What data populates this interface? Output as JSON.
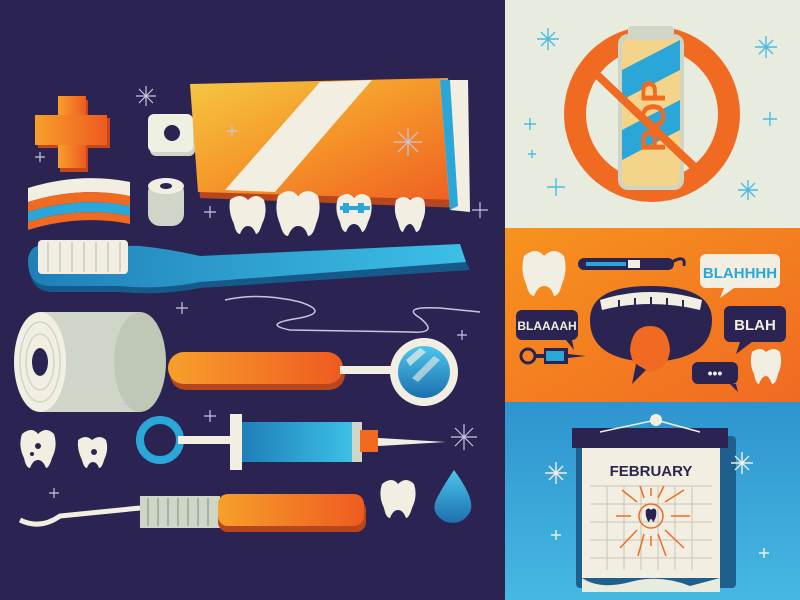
{
  "colors": {
    "navy": "#2b2452",
    "cream": "#f2efe2",
    "orange": "#f06a22",
    "orange_light": "#f7a02a",
    "yellow": "#f5c842",
    "blue": "#2aa7d8",
    "blue_dark": "#1a6f9c",
    "ink": "#2a2047",
    "teal_panel": "#35a6d6",
    "mint_panel": "#e7ecde"
  },
  "panels": {
    "pop": {
      "can_text": "POP"
    },
    "talk": {
      "bubbles": [
        "BLAHHHH",
        "BLAAAAH",
        "BLAH"
      ],
      "typing": "•••"
    },
    "calendar": {
      "month": "FEBRUARY"
    }
  },
  "icons": [
    "plus-icon",
    "toothpaste-tube-icon",
    "floss-stripes-icon",
    "tooth-icon",
    "toothbrush-icon",
    "floss-roll-icon",
    "dental-mirror-icon",
    "syringe-icon",
    "dental-pick-icon",
    "water-drop-icon",
    "no-soda-sign-icon",
    "open-mouth-icon",
    "calendar-icon",
    "sparkle-icon"
  ]
}
